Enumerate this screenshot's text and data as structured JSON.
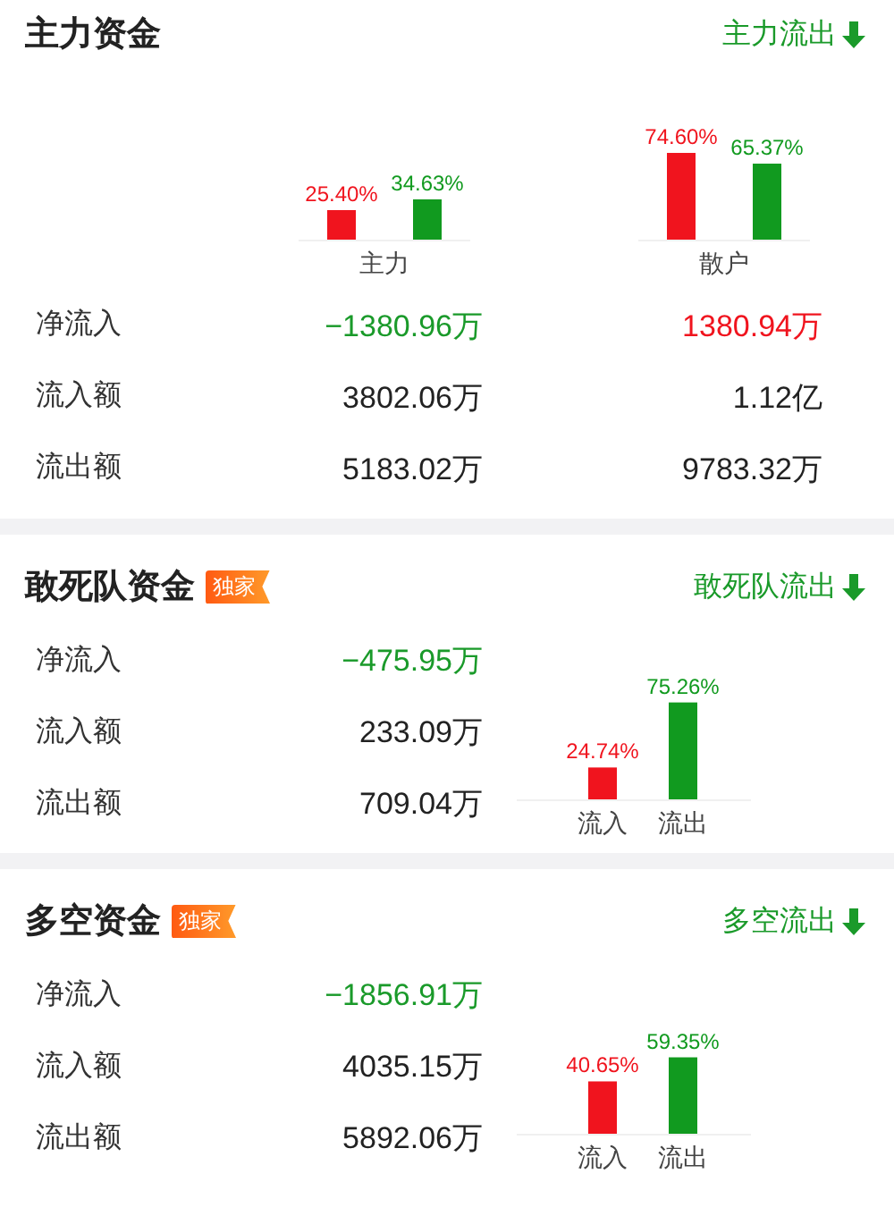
{
  "sections": [
    {
      "kind": "split",
      "title": "主力资金",
      "link": {
        "label": "主力流出",
        "color": "#1a9a2a"
      },
      "chart_data": {
        "type": "bar",
        "categories": [
          "主力",
          "散户"
        ],
        "series": [
          {
            "color": "#f0141e",
            "values": [
              25.4,
              74.6
            ],
            "value_labels": [
              "25.40%",
              "74.60%"
            ]
          },
          {
            "color": "#119a1f",
            "values": [
              34.63,
              65.37
            ],
            "value_labels": [
              "34.63%",
              "65.37%"
            ]
          }
        ]
      },
      "rows": [
        {
          "label": "净流入",
          "values": [
            {
              "text": "−1380.96万",
              "color": "#1a9a2a"
            },
            {
              "text": "1380.94万",
              "color": "#f0141e"
            }
          ]
        },
        {
          "label": "流入额",
          "values": [
            {
              "text": "3802.06万",
              "color": "#222222"
            },
            {
              "text": "1.12亿",
              "color": "#222222"
            }
          ]
        },
        {
          "label": "流出额",
          "values": [
            {
              "text": "5183.02万",
              "color": "#222222"
            },
            {
              "text": "9783.32万",
              "color": "#222222"
            }
          ]
        }
      ]
    },
    {
      "kind": "side",
      "title": "敢死队资金",
      "badge": "独家",
      "link": {
        "label": "敢死队流出",
        "color": "#1a9a2a"
      },
      "chart_data": {
        "type": "bar",
        "categories": [
          "流入",
          "流出"
        ],
        "series": [
          {
            "color": "#f0141e",
            "values": [
              24.74,
              null
            ],
            "value_labels": [
              "24.74%",
              null
            ]
          },
          {
            "color": "#119a1f",
            "values": [
              null,
              75.26
            ],
            "value_labels": [
              null,
              "75.26%"
            ]
          }
        ]
      },
      "rows": [
        {
          "label": "净流入",
          "values": [
            {
              "text": "−475.95万",
              "color": "#1a9a2a"
            }
          ]
        },
        {
          "label": "流入额",
          "values": [
            {
              "text": "233.09万",
              "color": "#222222"
            }
          ]
        },
        {
          "label": "流出额",
          "values": [
            {
              "text": "709.04万",
              "color": "#222222"
            }
          ]
        }
      ]
    },
    {
      "kind": "side",
      "title": "多空资金",
      "badge": "独家",
      "link": {
        "label": "多空流出",
        "color": "#1a9a2a"
      },
      "chart_data": {
        "type": "bar",
        "categories": [
          "流入",
          "流出"
        ],
        "series": [
          {
            "color": "#f0141e",
            "values": [
              40.65,
              null
            ],
            "value_labels": [
              "40.65%",
              null
            ]
          },
          {
            "color": "#119a1f",
            "values": [
              null,
              59.35
            ],
            "value_labels": [
              null,
              "59.35%"
            ]
          }
        ]
      },
      "rows": [
        {
          "label": "净流入",
          "values": [
            {
              "text": "−1856.91万",
              "color": "#1a9a2a"
            }
          ]
        },
        {
          "label": "流入额",
          "values": [
            {
              "text": "4035.15万",
              "color": "#222222"
            }
          ]
        },
        {
          "label": "流出额",
          "values": [
            {
              "text": "5892.06万",
              "color": "#222222"
            }
          ]
        }
      ]
    }
  ]
}
